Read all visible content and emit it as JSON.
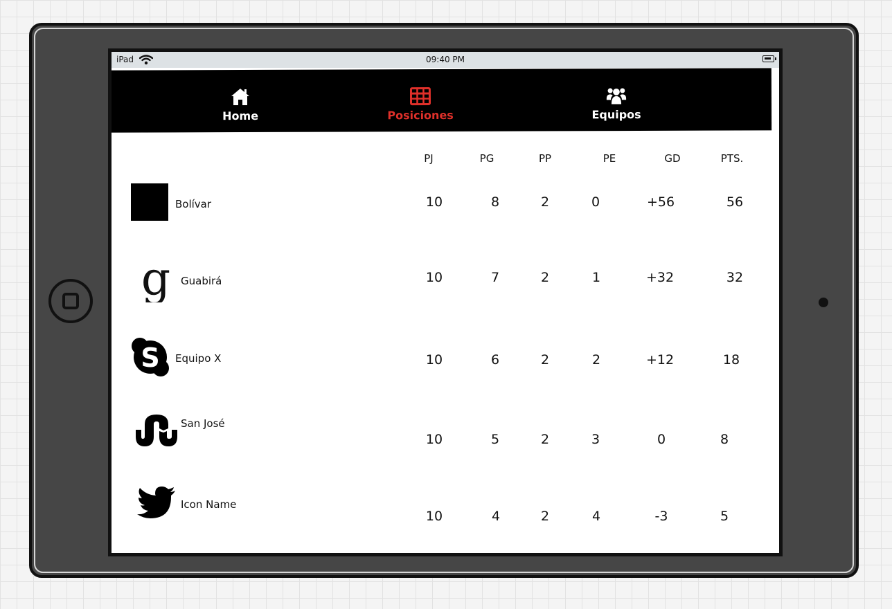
{
  "status_bar": {
    "carrier": "iPad",
    "time": "09:40 PM"
  },
  "nav": {
    "items": [
      {
        "label": "Home",
        "icon": "home-icon",
        "active": false
      },
      {
        "label": "Posiciones",
        "icon": "table-icon",
        "active": true
      },
      {
        "label": "Equipos",
        "icon": "users-icon",
        "active": false
      }
    ],
    "active_color": "#e0302a"
  },
  "table": {
    "columns": [
      "PJ",
      "PG",
      "PP",
      "PE",
      "GD",
      "PTS."
    ],
    "rows": [
      {
        "team": "Bolívar",
        "icon": "placeholder-square-icon",
        "pj": "10",
        "pg": "8",
        "pp": "2",
        "pe": "0",
        "gd": "+56",
        "pts": "56"
      },
      {
        "team": "Guabirá",
        "icon": "google-icon",
        "pj": "10",
        "pg": "7",
        "pp": "2",
        "pe": "1",
        "gd": "+32",
        "pts": "32"
      },
      {
        "team": "Equipo X",
        "icon": "skype-icon",
        "pj": "10",
        "pg": "6",
        "pp": "2",
        "pe": "2",
        "gd": "+12",
        "pts": "18"
      },
      {
        "team": "San José",
        "icon": "stumbleupon-icon",
        "pj": "10",
        "pg": "5",
        "pp": "2",
        "pe": "3",
        "gd": "0",
        "pts": "8"
      },
      {
        "team": "Icon Name",
        "icon": "twitter-icon",
        "pj": "10",
        "pg": "4",
        "pp": "2",
        "pe": "4",
        "gd": "-3",
        "pts": "5"
      }
    ]
  }
}
